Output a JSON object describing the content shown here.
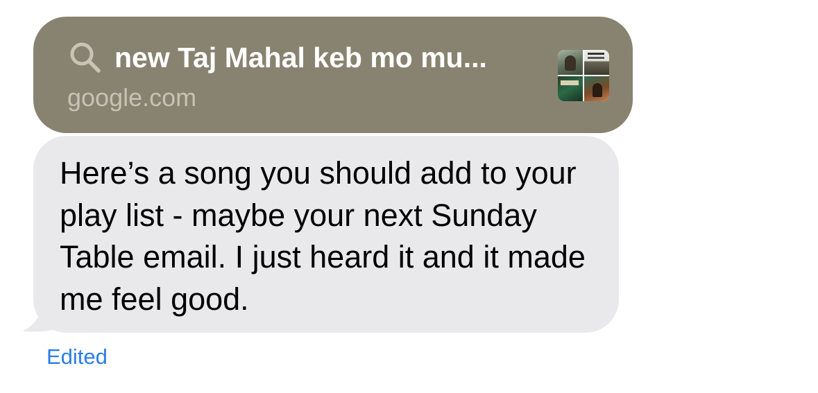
{
  "link_preview": {
    "title": "new Taj Mahal keb mo mu...",
    "domain": "google.com",
    "icon": "search-icon",
    "thumbnail": "album-art-collage",
    "background_color": "#888370"
  },
  "message": {
    "text": "Here’s a song you should add to your play list - maybe your next Sunday Table email. I just heard it and it made me feel good.",
    "bubble_color": "#e9e9eb",
    "status": "Edited",
    "status_color": "#2a7ee5"
  }
}
